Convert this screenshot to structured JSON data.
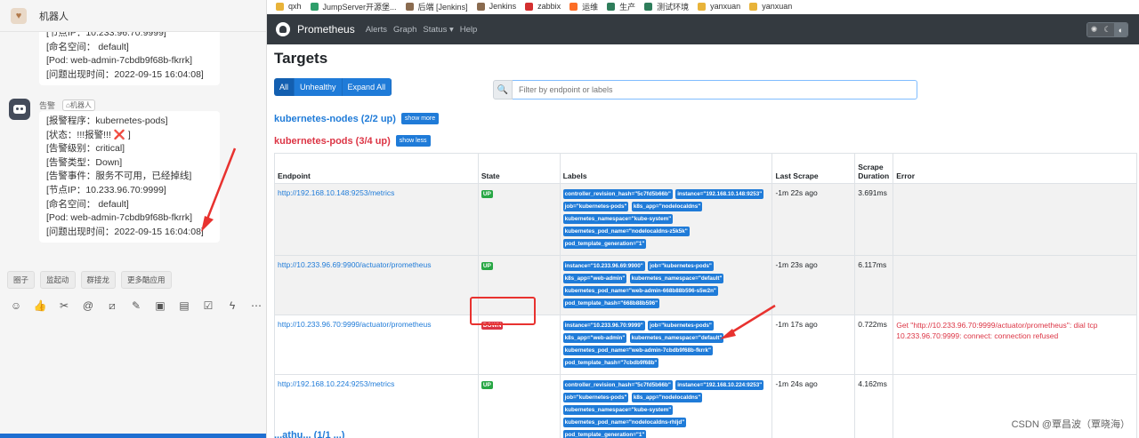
{
  "chat": {
    "title": "机器人",
    "message1_lines": [
      "[节点IP：10.233.96.70:9999]",
      "[命名空间：  default]",
      "[Pod:     web-admin-7cbdb9f68b-fkrrk]",
      "[问题出现时间：2022-09-15 16:04:08]"
    ],
    "sender_name": "告警",
    "sender_tag": "机器人",
    "message2": {
      "line1": "[报警程序：kubernetes-pods]",
      "line2_text": "[状态：!!!报警!!!",
      "line2_icon": "❌",
      "line2_end": "]",
      "line3": "[告警级别：critical]",
      "line4": "[告警类型：Down]",
      "line5": "[告警事件：服务不可用，已经掉线]",
      "line6": "[节点IP：10.233.96.70:9999]",
      "line7": "[命名空间：  default]",
      "line8": "[Pod:     web-admin-7cbdb9f68b-fkrrk]",
      "line9": "[问题出现时间：2022-09-15 16:04:08]"
    },
    "quick_actions": [
      "圈子",
      "监起动",
      "群接龙",
      "更多酷应用"
    ]
  },
  "bookmarks": [
    {
      "label": "qxh",
      "color": "#e8b339"
    },
    {
      "label": "JumpServer开源堡...",
      "color": "#2e9e6a"
    },
    {
      "label": "后端 [Jenkins]",
      "color": "#8a6b4f"
    },
    {
      "label": "Jenkins",
      "color": "#8a6b4f"
    },
    {
      "label": "zabbix",
      "color": "#d32f2f"
    },
    {
      "label": "运维",
      "color": "#fc6d26"
    },
    {
      "label": "生产",
      "color": "#2e7d5b"
    },
    {
      "label": "测试环境",
      "color": "#2e7d5b"
    },
    {
      "label": "yanxuan",
      "color": "#e8b339"
    },
    {
      "label": "yanxuan",
      "color": "#e8b339"
    }
  ],
  "nav": {
    "brand": "Prometheus",
    "links": [
      "Alerts",
      "Graph",
      "Status ▾",
      "Help"
    ]
  },
  "page": {
    "title": "Targets",
    "filters": [
      "All",
      "Unhealthy",
      "Expand All"
    ],
    "search_placeholder": "Filter by endpoint or labels"
  },
  "pools": {
    "pool1_title": "kubernetes-nodes (2/2 up)",
    "pool1_button": "show more",
    "pool2_title": "kubernetes-pods (3/4 up)",
    "pool2_button": "show less",
    "pool3_title": "...athu... (1/1 ...)"
  },
  "table": {
    "headers": {
      "endpoint": "Endpoint",
      "state": "State",
      "labels": "Labels",
      "last_scrape": "Last Scrape",
      "scrape_duration": "Scrape Duration",
      "error": "Error"
    },
    "rows": [
      {
        "endpoint": "http://192.168.10.148:9253/metrics",
        "state": "UP",
        "labels": [
          "controller_revision_hash=\"5c7fd5b66b\"",
          "instance=\"192.168.10.148:9253\"",
          "job=\"kubernetes-pods\"",
          "k8s_app=\"nodelocaldns\"",
          "kubernetes_namespace=\"kube-system\"",
          "kubernetes_pod_name=\"nodelocaldns-z5k5k\"",
          "pod_template_generation=\"1\""
        ],
        "last_scrape": "-1m 22s ago",
        "duration": "3.691ms",
        "error": ""
      },
      {
        "endpoint": "http://10.233.96.69:9900/actuator/prometheus",
        "state": "UP",
        "labels": [
          "instance=\"10.233.96.69:9900\"",
          "job=\"kubernetes-pods\"",
          "k8s_app=\"web-admin\"",
          "kubernetes_namespace=\"default\"",
          "kubernetes_pod_name=\"web-admin-668b88b596-s5w2n\"",
          "pod_template_hash=\"668b88b596\""
        ],
        "last_scrape": "-1m 23s ago",
        "duration": "6.117ms",
        "error": ""
      },
      {
        "endpoint": "http://10.233.96.70:9999/actuator/prometheus",
        "state": "DOWN",
        "labels": [
          "instance=\"10.233.96.70:9999\"",
          "job=\"kubernetes-pods\"",
          "k8s_app=\"web-admin\"",
          "kubernetes_namespace=\"default\"",
          "kubernetes_pod_name=\"web-admin-7cbdb9f68b-fkrrk\"",
          "pod_template_hash=\"7cbdb9f68b\""
        ],
        "last_scrape": "-1m 17s ago",
        "duration": "0.722ms",
        "error": "Get \"http://10.233.96.70:9999/actuator/prometheus\": dial tcp 10.233.96.70:9999: connect: connection refused"
      },
      {
        "endpoint": "http://192.168.10.224:9253/metrics",
        "state": "UP",
        "labels": [
          "controller_revision_hash=\"5c7fd5b66b\"",
          "instance=\"192.168.10.224:9253\"",
          "job=\"kubernetes-pods\"",
          "k8s_app=\"nodelocaldns\"",
          "kubernetes_namespace=\"kube-system\"",
          "kubernetes_pod_name=\"nodelocaldns-rhljd\"",
          "pod_template_generation=\"1\""
        ],
        "last_scrape": "-1m 24s ago",
        "duration": "4.162ms",
        "error": ""
      }
    ]
  },
  "watermark": "CSDN @覃昌波（覃晓海）"
}
